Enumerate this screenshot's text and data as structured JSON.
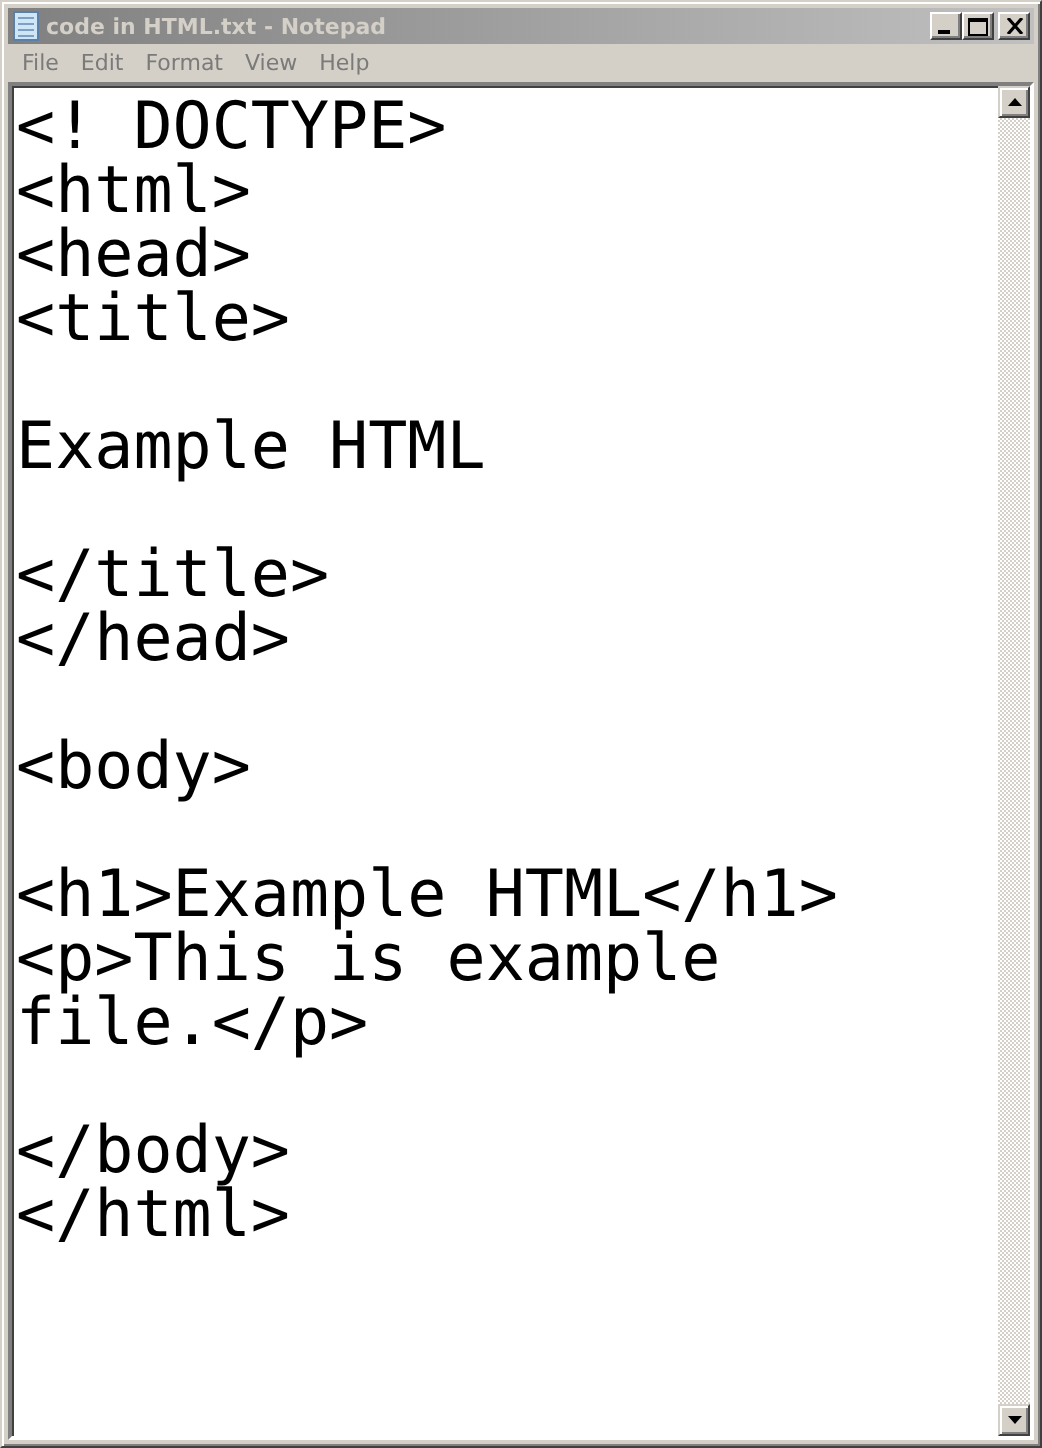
{
  "window": {
    "title": "code in HTML.txt - Notepad",
    "active": false
  },
  "menu": [
    {
      "label": "File"
    },
    {
      "label": "Edit"
    },
    {
      "label": "Format"
    },
    {
      "label": "View"
    },
    {
      "label": "Help"
    }
  ],
  "document": {
    "text": "<! DOCTYPE>\n<html>\n<head>\n<title>\n\nExample HTML\n\n</title>\n</head>\n\n<body>\n\n<h1>Example HTML</h1>\n<p>This is example file.</p>\n\n</body>\n</html>"
  }
}
